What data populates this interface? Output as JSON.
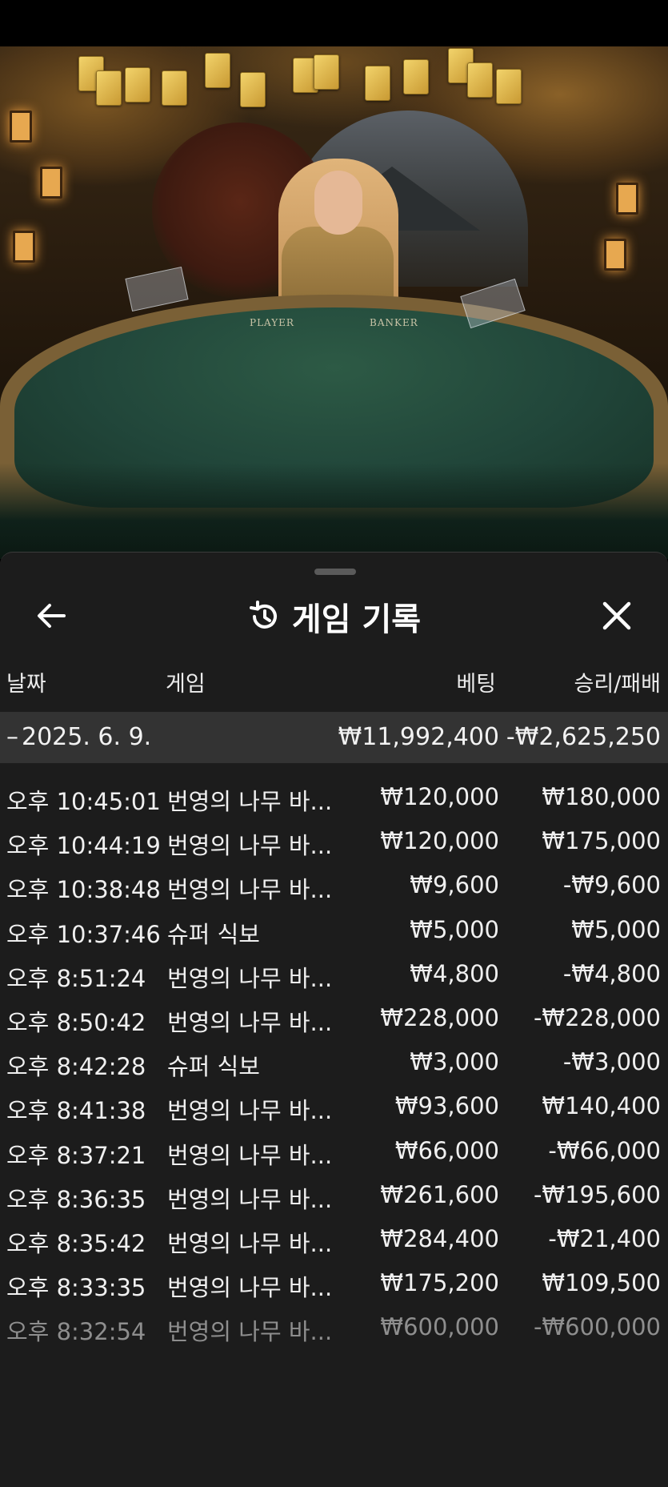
{
  "sheet": {
    "title": "게임 기록",
    "columns": {
      "date": "날짜",
      "game": "게임",
      "bet": "베팅",
      "result": "승리/패배"
    }
  },
  "scene": {
    "felt_left": "PLAYER",
    "felt_right": "BANKER"
  },
  "group": {
    "toggle": "–",
    "date": "2025. 6. 9.",
    "total_bet": "₩11,992,400",
    "total_result": "-₩2,625,250"
  },
  "rows": [
    {
      "time": "오후 10:45:01",
      "game": "번영의 나무 바...",
      "bet": "₩120,000",
      "result": "₩180,000"
    },
    {
      "time": "오후 10:44:19",
      "game": "번영의 나무 바...",
      "bet": "₩120,000",
      "result": "₩175,000"
    },
    {
      "time": "오후 10:38:48",
      "game": "번영의 나무 바...",
      "bet": "₩9,600",
      "result": "-₩9,600"
    },
    {
      "time": "오후 10:37:46",
      "game": "슈퍼 식보",
      "bet": "₩5,000",
      "result": "₩5,000"
    },
    {
      "time": "오후 8:51:24",
      "game": "번영의 나무 바...",
      "bet": "₩4,800",
      "result": "-₩4,800"
    },
    {
      "time": "오후 8:50:42",
      "game": "번영의 나무 바...",
      "bet": "₩228,000",
      "result": "-₩228,000"
    },
    {
      "time": "오후 8:42:28",
      "game": "슈퍼 식보",
      "bet": "₩3,000",
      "result": "-₩3,000"
    },
    {
      "time": "오후 8:41:38",
      "game": "번영의 나무 바...",
      "bet": "₩93,600",
      "result": "₩140,400"
    },
    {
      "time": "오후 8:37:21",
      "game": "번영의 나무 바...",
      "bet": "₩66,000",
      "result": "-₩66,000"
    },
    {
      "time": "오후 8:36:35",
      "game": "번영의 나무 바...",
      "bet": "₩261,600",
      "result": "-₩195,600"
    },
    {
      "time": "오후 8:35:42",
      "game": "번영의 나무 바...",
      "bet": "₩284,400",
      "result": "-₩21,400"
    },
    {
      "time": "오후 8:33:35",
      "game": "번영의 나무 바...",
      "bet": "₩175,200",
      "result": "₩109,500"
    },
    {
      "time": "오후 8:32:54",
      "game": "번영의 나무 바...",
      "bet": "₩600,000",
      "result": "-₩600,000"
    }
  ]
}
